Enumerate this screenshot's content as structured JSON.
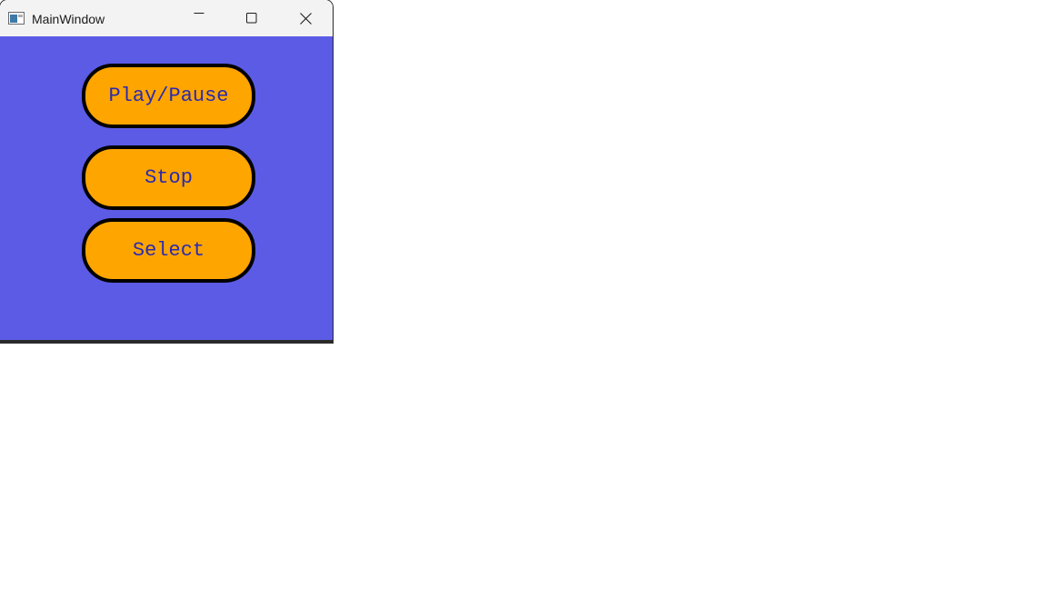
{
  "window": {
    "title": "MainWindow",
    "icon": "app-window-icon",
    "controls": {
      "minimize": "minimize-icon",
      "maximize": "maximize-icon",
      "close": "close-icon"
    }
  },
  "buttons": {
    "play_pause": "Play/Pause",
    "stop": "Stop",
    "select": "Select"
  },
  "colors": {
    "client_background": "#5b5be6",
    "button_fill": "#ffa500",
    "button_border": "#000000",
    "button_text": "#2a2ab0"
  }
}
